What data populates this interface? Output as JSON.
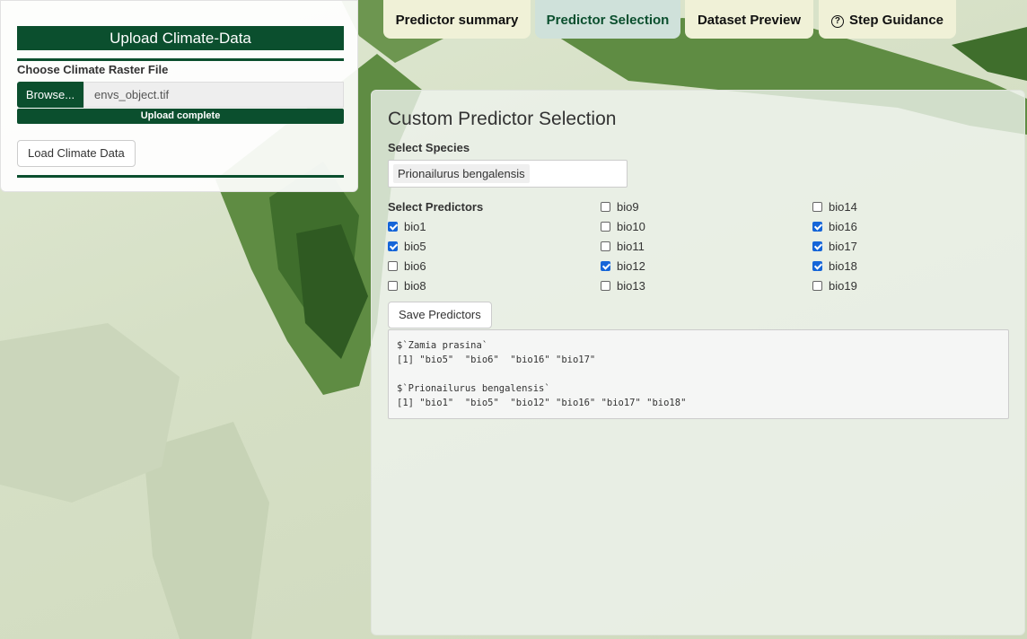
{
  "upload": {
    "title": "Upload Climate-Data",
    "file_label": "Choose Climate Raster File",
    "browse_label": "Browse...",
    "file_name": "envs_object.tif",
    "progress_text": "Upload complete",
    "progress": 1.0,
    "load_button": "Load Climate Data"
  },
  "tabs": [
    {
      "label": "Predictor summary",
      "active": false
    },
    {
      "label": "Predictor Selection",
      "active": true
    },
    {
      "label": "Dataset Preview",
      "active": false
    },
    {
      "label": "Step Guidance",
      "active": false,
      "icon": "question-circle-icon"
    }
  ],
  "main": {
    "title": "Custom Predictor Selection",
    "species_label": "Select Species",
    "species_selected": "Prionailurus bengalensis",
    "predictors_label": "Select Predictors",
    "predictors": [
      {
        "label": "bio1",
        "checked": true
      },
      {
        "label": "bio5",
        "checked": true
      },
      {
        "label": "bio6",
        "checked": false
      },
      {
        "label": "bio8",
        "checked": false
      },
      {
        "label": "bio9",
        "checked": false
      },
      {
        "label": "bio10",
        "checked": false
      },
      {
        "label": "bio11",
        "checked": false
      },
      {
        "label": "bio12",
        "checked": true
      },
      {
        "label": "bio13",
        "checked": false
      },
      {
        "label": "bio14",
        "checked": false
      },
      {
        "label": "bio16",
        "checked": true
      },
      {
        "label": "bio17",
        "checked": true
      },
      {
        "label": "bio18",
        "checked": true
      },
      {
        "label": "bio19",
        "checked": false
      }
    ],
    "save_button": "Save Predictors",
    "output": "$`Zamia prasina`\n[1] \"bio5\"  \"bio6\"  \"bio16\" \"bio17\"\n\n$`Prionailurus bengalensis`\n[1] \"bio1\"  \"bio5\"  \"bio12\" \"bio16\" \"bio17\" \"bio18\""
  },
  "colors": {
    "brand_green": "#0b4f2e",
    "active_tab": "#cfe1da",
    "inactive_tab": "#f0f1d7",
    "checkbox_checked": "#1565d8"
  }
}
